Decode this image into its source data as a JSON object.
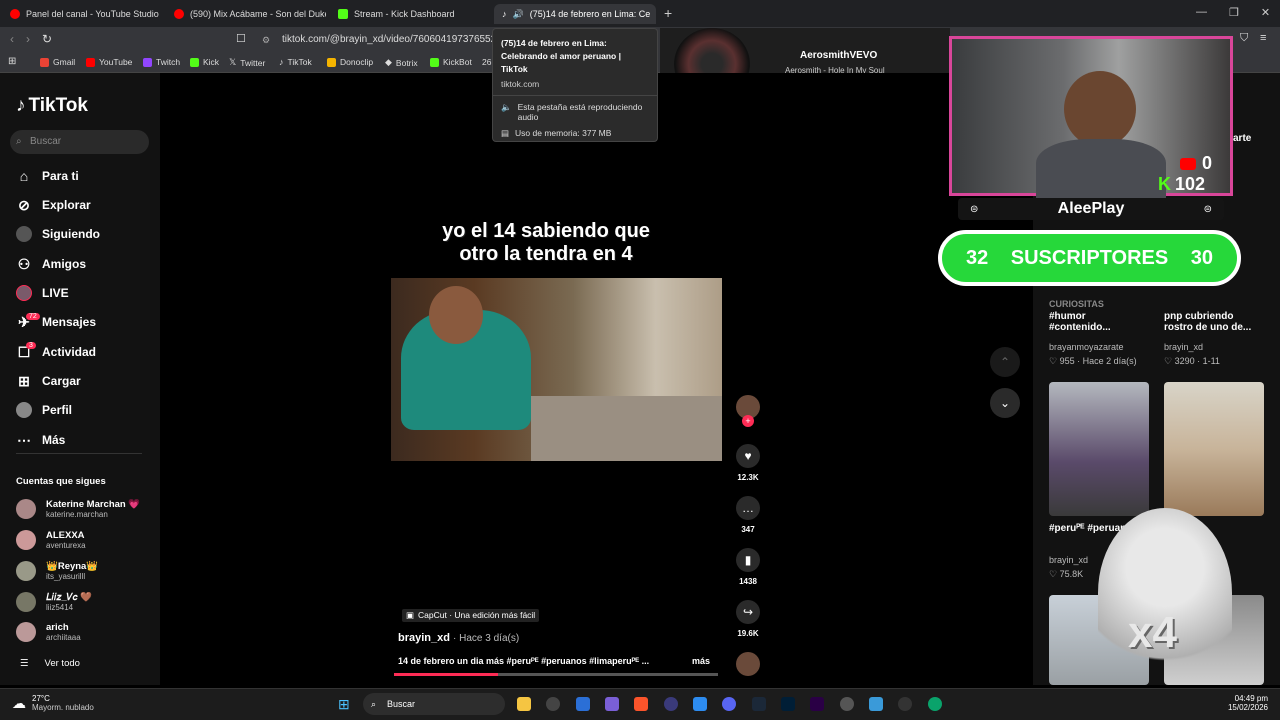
{
  "tabs": [
    {
      "label": "Panel del canal - YouTube Studio",
      "color": "#ff0000"
    },
    {
      "label": "(590) Mix Acábame - Son del Duke -",
      "color": "#ff0000"
    },
    {
      "label": "Stream - Kick Dashboard",
      "color": "#53fc18"
    },
    {
      "label": "(75)14 de febrero en Lima: Ce",
      "color": "#ffffff"
    }
  ],
  "address": {
    "url": "tiktok.com/@brayin_xd/video/76060419737655247"
  },
  "bookmarks": [
    {
      "label": "Gmail",
      "color": "#ea4335"
    },
    {
      "label": "YouTube",
      "color": "#ff0000"
    },
    {
      "label": "Twitch",
      "color": "#9146ff"
    },
    {
      "label": "Kick",
      "color": "#53fc18"
    },
    {
      "label": "Twitter",
      "color": "#ffffff"
    },
    {
      "label": "TikTok",
      "color": "#ffffff"
    },
    {
      "label": "Donoclip",
      "color": "#f5b400"
    },
    {
      "label": "Botrix",
      "color": "#ffffff"
    },
    {
      "label": "KickBot",
      "color": "#53fc18"
    },
    {
      "label": "26"
    }
  ],
  "media": {
    "channel": "AerosmithVEVO",
    "track": "Aerosmith - Hole In My Soul"
  },
  "tooltip": {
    "title": "(75)14 de febrero en Lima: Celebrando el amor peruano | TikTok",
    "domain": "tiktok.com",
    "audio": "Esta pestaña está reproduciendo audio",
    "memory": "Uso de memoria: 377 MB"
  },
  "sidebar": {
    "logo": "TikTok",
    "search_placeholder": "Buscar",
    "items": [
      {
        "label": "Para ti",
        "icon": "home-icon"
      },
      {
        "label": "Explorar",
        "icon": "compass-icon"
      },
      {
        "label": "Siguiendo",
        "icon": "following-icon"
      },
      {
        "label": "Amigos",
        "icon": "friends-icon"
      },
      {
        "label": "LIVE",
        "icon": "live-icon"
      },
      {
        "label": "Mensajes",
        "icon": "messages-icon",
        "badge": "72"
      },
      {
        "label": "Actividad",
        "icon": "activity-icon",
        "badge": "3"
      },
      {
        "label": "Cargar",
        "icon": "upload-icon"
      },
      {
        "label": "Perfil",
        "icon": "profile-icon"
      },
      {
        "label": "Más",
        "icon": "more-icon"
      }
    ],
    "following_title": "Cuentas que sigues",
    "following": [
      {
        "name": "Katerine Marchan 💗",
        "handle": "katerine.marchan"
      },
      {
        "name": "ALEXXA",
        "handle": "aventurexa"
      },
      {
        "name": "👑Reyna👑",
        "handle": "its_yasurilll"
      },
      {
        "name": "𝐿𝑖𝑖𝑧_𝑉𝑐 🤎",
        "handle": "liiz5414"
      },
      {
        "name": "arich",
        "handle": "archiitaaa"
      }
    ],
    "see_all": "Ver todo"
  },
  "video": {
    "overlay_text_1": "yo el 14 sabiendo que",
    "overlay_text_2": "otro la tendra en 4",
    "capcut": "CapCut · Una edición más fácil",
    "author": "brayin_xd",
    "time": "· Hace 3 día(s)",
    "description": "14 de febrero un dia más #peruᴾᴱ #peruanos #limaperuᴾᴱ ...",
    "more": "más",
    "likes": "12.3K",
    "comments": "347",
    "saves": "1438",
    "shares": "19.6K"
  },
  "stream": {
    "youtube_count": "0",
    "kick_count": "102",
    "name": "AleePlay",
    "subs_left": "32",
    "subs_label": "SUSCRIPTORES",
    "subs_right": "30",
    "x4": "x4"
  },
  "related": [
    {
      "title": "#humor #contenido...",
      "author": "brayanmoyazarate",
      "stats": "♡ 955 · Hace 2 día(s)"
    },
    {
      "title": "pnp cubriendo rostro de uno de...",
      "author": "brayin_xd",
      "stats": "♡ 3290 · 1-11"
    },
    {
      "title": "#peruᴾᴱ #peruanos",
      "author": "brayin_xd",
      "stats": "♡ 75.8K"
    },
    {
      "title": "",
      "author": "",
      "stats": ""
    }
  ],
  "related_header": "CURIOSITAS",
  "top_right": "arte",
  "taskbar": {
    "weather_temp": "27°C",
    "weather_desc": "Mayorm. nublado",
    "search": "Buscar",
    "time": "04:49 pm",
    "date": "15/02/2026"
  }
}
